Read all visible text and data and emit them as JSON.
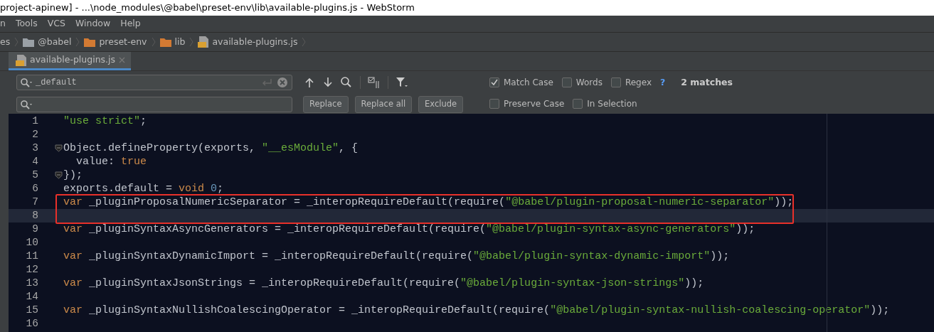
{
  "window": {
    "title": "project-apinew] - ...\\node_modules\\@babel\\preset-env\\lib\\available-plugins.js - WebStorm"
  },
  "menu": [
    "n",
    "Tools",
    "VCS",
    "Window",
    "Help"
  ],
  "breadcrumb": [
    {
      "label": "es",
      "kind": "none"
    },
    {
      "label": "@babel",
      "kind": "folder-grey"
    },
    {
      "label": "preset-env",
      "kind": "folder"
    },
    {
      "label": "lib",
      "kind": "folder"
    },
    {
      "label": "available-plugins.js",
      "kind": "js"
    }
  ],
  "tabs": [
    {
      "label": "available-plugins.js",
      "selected": true
    }
  ],
  "find": {
    "search_value": "_default",
    "buttons": [
      "Replace",
      "Replace all",
      "Exclude"
    ],
    "options_top": [
      {
        "label": "Match Case",
        "checked": true
      },
      {
        "label": "Words",
        "checked": false
      },
      {
        "label": "Regex",
        "checked": false
      }
    ],
    "options_bottom": [
      {
        "label": "Preserve Case",
        "checked": false
      },
      {
        "label": "In Selection",
        "checked": false
      }
    ],
    "help": "?",
    "result": "2 matches"
  },
  "editor": {
    "lines": [
      {
        "number": "1",
        "fold": false,
        "current": false,
        "boxed": false,
        "tokens": [
          {
            "text": "\"use strict\"",
            "kind": "string"
          },
          {
            "text": ";",
            "kind": "plain"
          }
        ]
      },
      {
        "number": "2",
        "fold": false,
        "current": false,
        "boxed": false
      },
      {
        "number": "3",
        "fold": true,
        "current": false,
        "boxed": false,
        "tokens": [
          {
            "text": "Object.defineProperty(exports, ",
            "kind": "plain"
          },
          {
            "text": "\"__esModule\"",
            "kind": "string"
          },
          {
            "text": ", {",
            "kind": "plain"
          }
        ]
      },
      {
        "number": "4",
        "fold": false,
        "current": false,
        "boxed": false,
        "tokens": [
          {
            "text": "  value: ",
            "kind": "plain"
          },
          {
            "text": "true",
            "kind": "keyword"
          }
        ]
      },
      {
        "number": "5",
        "fold": true,
        "current": false,
        "boxed": false,
        "tokens": [
          {
            "text": "});",
            "kind": "plain"
          }
        ]
      },
      {
        "number": "6",
        "fold": false,
        "current": false,
        "boxed": false,
        "tokens": [
          {
            "text": "exports.default = ",
            "kind": "plain"
          },
          {
            "text": "void",
            "kind": "keyword"
          },
          {
            "text": " 0",
            "kind": "number"
          },
          {
            "text": ";",
            "kind": "plain"
          }
        ]
      },
      {
        "number": "7",
        "fold": false,
        "current": false,
        "boxed": true,
        "tokens": [
          {
            "text": "var",
            "kind": "keyword"
          },
          {
            "text": " _pluginProposalNumericSeparator = _interopRequireDefault(require(",
            "kind": "plain"
          },
          {
            "text": "\"@babel/plugin-proposal-numeric-separator\"",
            "kind": "string"
          },
          {
            "text": "));",
            "kind": "plain"
          }
        ]
      },
      {
        "number": "8",
        "fold": false,
        "current": true,
        "boxed": true
      },
      {
        "number": "9",
        "fold": false,
        "current": false,
        "boxed": false,
        "tokens": [
          {
            "text": "var",
            "kind": "keyword"
          },
          {
            "text": " _pluginSyntaxAsyncGenerators = _interopRequireDefault(require(",
            "kind": "plain"
          },
          {
            "text": "\"@babel/plugin-syntax-async-generators\"",
            "kind": "string"
          },
          {
            "text": "));",
            "kind": "plain"
          }
        ]
      },
      {
        "number": "10",
        "fold": false,
        "current": false,
        "boxed": false
      },
      {
        "number": "11",
        "fold": false,
        "current": false,
        "boxed": false,
        "tokens": [
          {
            "text": "var",
            "kind": "keyword"
          },
          {
            "text": " _pluginSyntaxDynamicImport = _interopRequireDefault(require(",
            "kind": "plain"
          },
          {
            "text": "\"@babel/plugin-syntax-dynamic-import\"",
            "kind": "string"
          },
          {
            "text": "));",
            "kind": "plain"
          }
        ]
      },
      {
        "number": "12",
        "fold": false,
        "current": false,
        "boxed": false
      },
      {
        "number": "13",
        "fold": false,
        "current": false,
        "boxed": false,
        "tokens": [
          {
            "text": "var",
            "kind": "keyword"
          },
          {
            "text": " _pluginSyntaxJsonStrings = _interopRequireDefault(require(",
            "kind": "plain"
          },
          {
            "text": "\"@babel/plugin-syntax-json-strings\"",
            "kind": "string"
          },
          {
            "text": "));",
            "kind": "plain"
          }
        ]
      },
      {
        "number": "14",
        "fold": false,
        "current": false,
        "boxed": false
      },
      {
        "number": "15",
        "fold": false,
        "current": false,
        "boxed": false,
        "tokens": [
          {
            "text": "var",
            "kind": "keyword"
          },
          {
            "text": " _pluginSyntaxNullishCoalescingOperator = _interopRequireDefault(require(",
            "kind": "plain"
          },
          {
            "text": "\"@babel/plugin-syntax-nullish-coalescing-operator\"",
            "kind": "string"
          },
          {
            "text": "));",
            "kind": "plain"
          }
        ]
      },
      {
        "number": "16",
        "fold": false,
        "current": false,
        "boxed": false
      }
    ]
  }
}
